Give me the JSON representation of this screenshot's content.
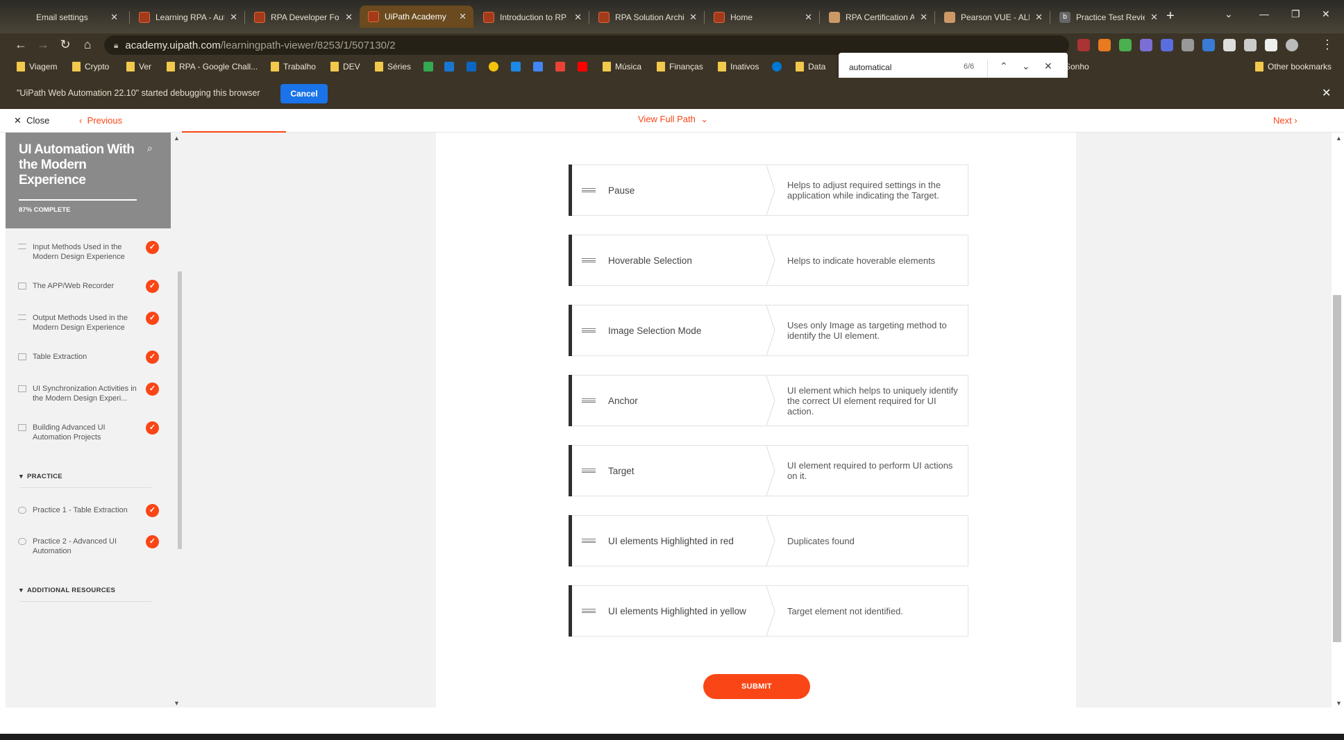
{
  "browser": {
    "tabs": [
      {
        "title": "Email settings",
        "icon": "gear-icon",
        "active": false
      },
      {
        "title": "Learning RPA - Aut",
        "icon": "uipath-icon",
        "active": false
      },
      {
        "title": "RPA Developer Fo",
        "icon": "uipath-icon",
        "active": false
      },
      {
        "title": "UiPath Academy",
        "icon": "uipath-icon",
        "active": true
      },
      {
        "title": "Introduction to RP",
        "icon": "uipath-icon",
        "active": false
      },
      {
        "title": "RPA Solution Archi",
        "icon": "uipath-icon",
        "active": false
      },
      {
        "title": "Home",
        "icon": "uipath-icon",
        "active": false
      },
      {
        "title": "RPA Certification A",
        "icon": "pearson-icon",
        "active": false
      },
      {
        "title": "Pearson VUE - ALE",
        "icon": "pearson-icon",
        "active": false
      },
      {
        "title": "Practice Test Revie",
        "icon": "b-icon",
        "active": false
      }
    ],
    "url_domain": "academy.uipath.com",
    "url_path": "/learningpath-viewer/8253/1/507130/2",
    "bookmarks": [
      {
        "label": "Viagem",
        "type": "folder"
      },
      {
        "label": "Crypto",
        "type": "folder"
      },
      {
        "label": "Ver",
        "type": "folder"
      },
      {
        "label": "RPA - Google Chall...",
        "type": "folder"
      },
      {
        "label": "Trabalho",
        "type": "folder"
      },
      {
        "label": "DEV",
        "type": "folder"
      },
      {
        "label": "Séries",
        "type": "folder"
      },
      {
        "label": "Música",
        "type": "folder"
      },
      {
        "label": "Finanças",
        "type": "folder"
      },
      {
        "label": "Inativos",
        "type": "folder"
      },
      {
        "label": "Data",
        "type": "folder"
      },
      {
        "label": "Sonho",
        "type": "folder"
      },
      {
        "label": "Other bookmarks",
        "type": "folder"
      }
    ],
    "find": {
      "query": "automatical",
      "count": "6/6"
    },
    "debug": {
      "message": "\"UiPath Web Automation 22.10\" started debugging this browser",
      "cancel_label": "Cancel"
    }
  },
  "header": {
    "close_label": "Close",
    "previous_label": "Previous",
    "view_path_label": "View Full Path",
    "next_label": "Next"
  },
  "sidebar": {
    "course_title": "UI Automation With the Modern Experience",
    "progress_text": "87% COMPLETE",
    "progress": 0.87,
    "lessons": [
      {
        "title": "Input Methods Used in the Modern Design Experience",
        "completed": true
      },
      {
        "title": "The APP/Web Recorder",
        "completed": true
      },
      {
        "title": "Output Methods Used in the Modern Design Experience",
        "completed": true
      },
      {
        "title": "Table Extraction",
        "completed": true
      },
      {
        "title": "UI Synchronization Activities in the Modern Design Experi...",
        "completed": true
      },
      {
        "title": "Building Advanced UI Automation Projects",
        "completed": true
      }
    ],
    "practice_header": "PRACTICE",
    "practice": [
      {
        "title": "Practice 1 - Table Extraction",
        "completed": true
      },
      {
        "title": "Practice 2 - Advanced UI Automation",
        "completed": true
      }
    ],
    "additional_header": "ADDITIONAL RESOURCES"
  },
  "matching": {
    "pairs": [
      {
        "term": "Pause",
        "definition": "Helps to adjust required settings in the application while indicating the Target."
      },
      {
        "term": "Hoverable Selection",
        "definition": "Helps to indicate hoverable elements"
      },
      {
        "term": "Image Selection Mode",
        "definition": "Uses only Image as targeting method to identify the UI element."
      },
      {
        "term": "Anchor",
        "definition": "UI element which helps to uniquely identify the correct UI element required for UI action."
      },
      {
        "term": "Target",
        "definition": "UI element required to perform UI actions on it."
      },
      {
        "term": "UI elements Highlighted in red",
        "definition": "Duplicates found"
      },
      {
        "term": "UI elements Highlighted in yellow",
        "definition": "Target element not identified."
      }
    ],
    "submit_label": "SUBMIT"
  },
  "colors": {
    "accent": "#fa4616",
    "link_blue": "#1a73e8"
  }
}
